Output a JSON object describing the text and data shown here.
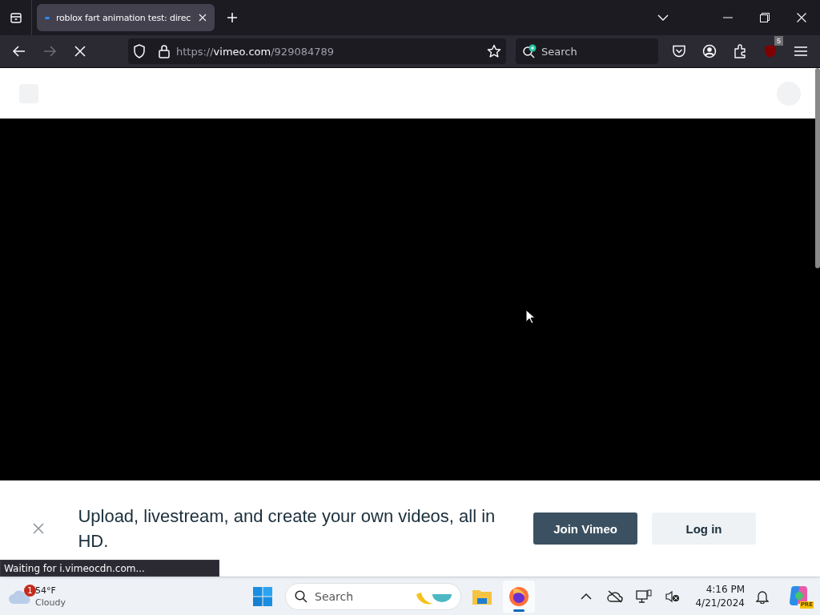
{
  "browser": {
    "tabs": [
      {
        "title": "roblox fart animation test: direc",
        "selected": true
      }
    ],
    "loading": true,
    "address": {
      "scheme": "https://",
      "host": "vimeo.com",
      "path": "/929084789"
    },
    "search": {
      "placeholder": "Search"
    },
    "extension_badge": "5"
  },
  "banner": {
    "message": "Upload, livestream, and create your own videos, all in HD.",
    "buttons": [
      {
        "label": "Join Vimeo",
        "kind": "primary"
      },
      {
        "label": "Log in",
        "kind": "secondary"
      }
    ]
  },
  "status_text": "Waiting for i.vimeocdn.com...",
  "taskbar": {
    "weather": {
      "temperature": "54°F",
      "condition": "Cloudy",
      "badge": "1"
    },
    "search": {
      "placeholder": "Search"
    },
    "apps": [
      {
        "kind": "folder",
        "active": false
      },
      {
        "kind": "browser",
        "active": true
      }
    ],
    "time": "4:16 PM",
    "date": "4/21/2024",
    "copilot_badge": "PRE"
  }
}
